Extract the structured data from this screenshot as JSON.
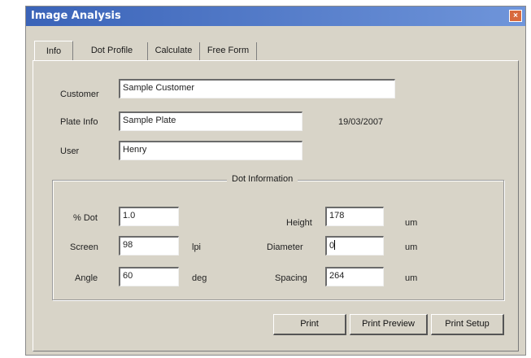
{
  "window": {
    "title": "Image Analysis",
    "close_symbol": "×"
  },
  "tabs": [
    "Info",
    "Dot Profile",
    "Calculate",
    "Free Form"
  ],
  "form": {
    "customer_label": "Customer",
    "customer_value": "Sample Customer",
    "plate_info_label": "Plate Info",
    "plate_info_value": "Sample Plate",
    "date": "19/03/2007",
    "user_label": "User",
    "user_value": "Henry"
  },
  "dot_info": {
    "title": "Dot Information",
    "percent_dot_label": "% Dot",
    "percent_dot_value": "1.0",
    "screen_label": "Screen",
    "screen_value": "98",
    "screen_unit": "lpi",
    "angle_label": "Angle",
    "angle_value": "60",
    "angle_unit": "deg",
    "height_label": "Height",
    "height_value": "178",
    "height_unit": "um",
    "diameter_label": "Diameter",
    "diameter_value": "0",
    "diameter_unit": "um",
    "spacing_label": "Spacing",
    "spacing_value": "264",
    "spacing_unit": "um"
  },
  "buttons": {
    "print": "Print",
    "print_preview": "Print Preview",
    "print_setup": "Print Setup"
  },
  "colors": {
    "titlebar_start": "#3a63b8",
    "titlebar_end": "#6f95da",
    "dialog_bg": "#d8d4c8",
    "close_button": "#d86a3e"
  }
}
